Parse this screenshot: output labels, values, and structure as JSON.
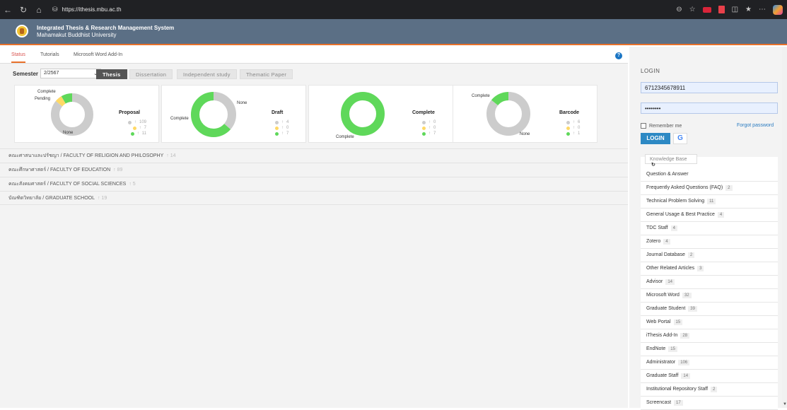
{
  "browser": {
    "url": "https://ithesis.mbu.ac.th",
    "back_icon": "back-arrow-icon",
    "refresh_icon": "refresh-icon",
    "home_icon": "home-icon"
  },
  "header": {
    "title": "Integrated Thesis & Research Management System",
    "subtitle": "Mahamakut Buddhist University"
  },
  "tabs": [
    {
      "label": "Status",
      "active": true
    },
    {
      "label": "Tutorials",
      "active": false
    },
    {
      "label": "Microsoft Word Add-In",
      "active": false
    }
  ],
  "semester": {
    "label": "Semester",
    "value": "2/2567"
  },
  "types": [
    {
      "label": "Thesis",
      "active": true
    },
    {
      "label": "Dissertation",
      "active": false
    },
    {
      "label": "Independent study",
      "active": false
    },
    {
      "label": "Thematic Paper",
      "active": false
    }
  ],
  "colors": {
    "none": "#cccccc",
    "pending": "#ffd966",
    "complete": "#5fd85a",
    "accent": "#e8712a",
    "header": "#5b6f85"
  },
  "chart_data": [
    {
      "type": "pie",
      "title": "Proposal",
      "categories": [
        "None",
        "Pending",
        "Complete"
      ],
      "values": [
        109,
        7,
        11
      ],
      "legend_symbols": [
        "↑",
        "↑",
        "↑"
      ]
    },
    {
      "type": "pie",
      "title": "Draft",
      "categories": [
        "None",
        "Pending",
        "Complete"
      ],
      "values": [
        4,
        0,
        7
      ]
    },
    {
      "type": "pie",
      "title": "Complete",
      "categories": [
        "None",
        "Pending",
        "Complete"
      ],
      "values": [
        0,
        0,
        7
      ]
    },
    {
      "type": "pie",
      "title": "Barcode",
      "categories": [
        "None",
        "Pending",
        "Complete"
      ],
      "values": [
        6,
        0,
        1
      ]
    }
  ],
  "legend_prefix": "↑",
  "slice_labels": {
    "none": "None",
    "pending": "Pending",
    "complete": "Complete"
  },
  "faculties": [
    {
      "name": "คณะศาสนาและปรัชญา / FACULTY OF RELIGION AND PHILOSOPHY",
      "count": "↑ 14"
    },
    {
      "name": "คณะศึกษาศาสตร์ / FACULTY OF EDUCATION",
      "count": "↑ 89"
    },
    {
      "name": "คณะสังคมศาสตร์ / FACULTY OF SOCIAL SCIENCES",
      "count": "↑ 5"
    },
    {
      "name": "บัณฑิตวิทยาลัย / GRADUATE SCHOOL",
      "count": "↑ 19"
    }
  ],
  "login": {
    "title": "LOGIN",
    "username": "6712345678911",
    "password": "••••••••",
    "remember": "Remember me",
    "forgot": "Forgot password",
    "button": "LOGIN",
    "google": "G"
  },
  "kb": {
    "title": "Knowledge Base",
    "items": [
      {
        "label": "Question & Answer",
        "count": ""
      },
      {
        "label": "Frequently Asked Questions (FAQ)",
        "count": "2"
      },
      {
        "label": "Technical Problem Solving",
        "count": "11"
      },
      {
        "label": "General Usage & Best Practice",
        "count": "4"
      },
      {
        "label": "TDC Staff",
        "count": "4"
      },
      {
        "label": "Zotero",
        "count": "4"
      },
      {
        "label": "Journal Database",
        "count": "2"
      },
      {
        "label": "Other Related Articles",
        "count": "3"
      },
      {
        "label": "Advisor",
        "count": "14"
      },
      {
        "label": "Microsoft Word",
        "count": "32"
      },
      {
        "label": "Graduate Student",
        "count": "39"
      },
      {
        "label": "Web Portal",
        "count": "15"
      },
      {
        "label": "iThesis Add-In",
        "count": "28"
      },
      {
        "label": "EndNote",
        "count": "15"
      },
      {
        "label": "Administrator",
        "count": "106"
      },
      {
        "label": "Graduate Staff",
        "count": "14"
      },
      {
        "label": "Institutional Repository Staff",
        "count": "2"
      },
      {
        "label": "Screencast",
        "count": "17"
      }
    ]
  }
}
